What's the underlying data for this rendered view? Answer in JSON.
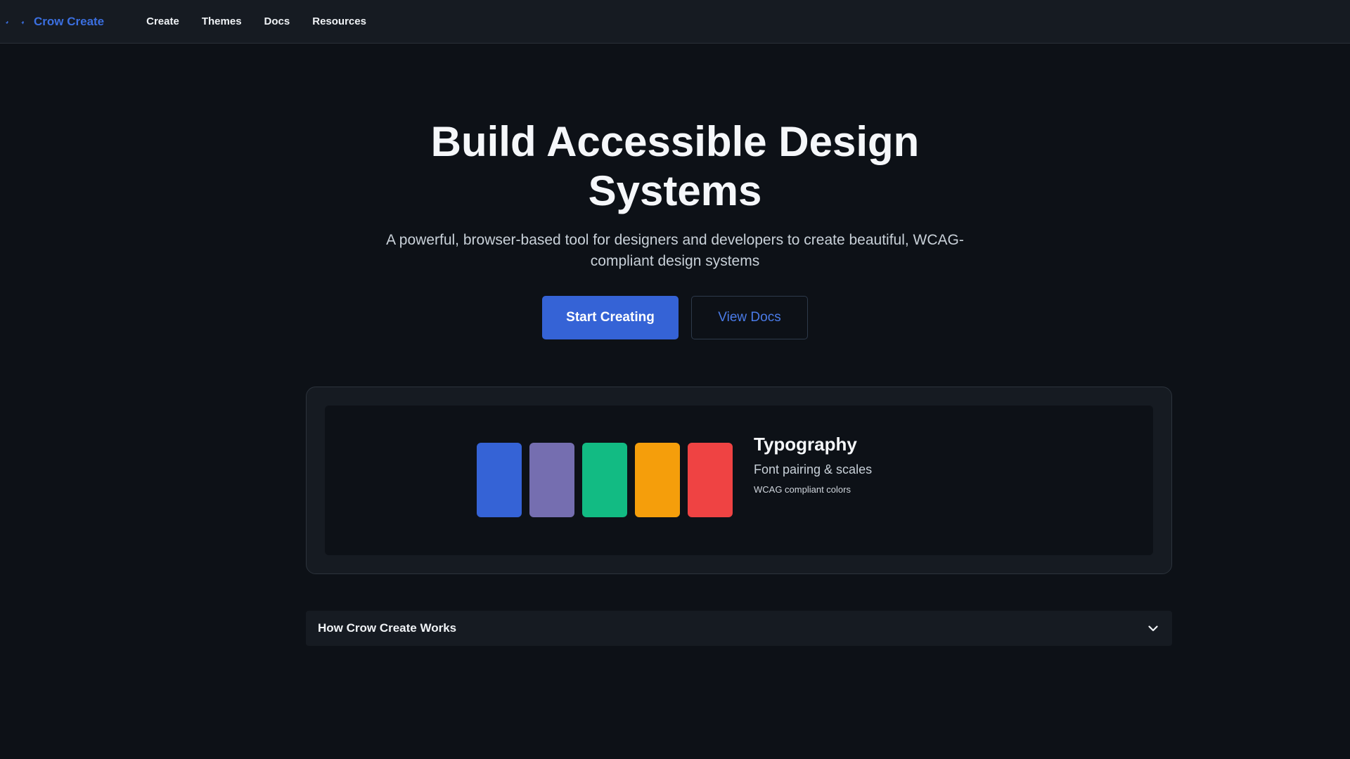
{
  "header": {
    "brand": "Crow Create",
    "nav": [
      "Create",
      "Themes",
      "Docs",
      "Resources"
    ]
  },
  "hero": {
    "title": "Build Accessible Design Systems",
    "subtitle": "A powerful, browser-based tool for designers and developers to create beautiful, WCAG-compliant design systems",
    "primary_cta": "Start Creating",
    "secondary_cta": "View Docs"
  },
  "preview": {
    "swatches": [
      "#3563d6",
      "#756eb0",
      "#12bb83",
      "#f59e0b",
      "#ef4343"
    ],
    "typography_title": "Typography",
    "typography_subtitle": "Font pairing & scales",
    "typography_note": "WCAG compliant colors"
  },
  "accordion": {
    "label": "How Crow Create Works"
  },
  "colors": {
    "accent": "#3563d6",
    "background": "#0d1117",
    "surface": "#161b22"
  }
}
